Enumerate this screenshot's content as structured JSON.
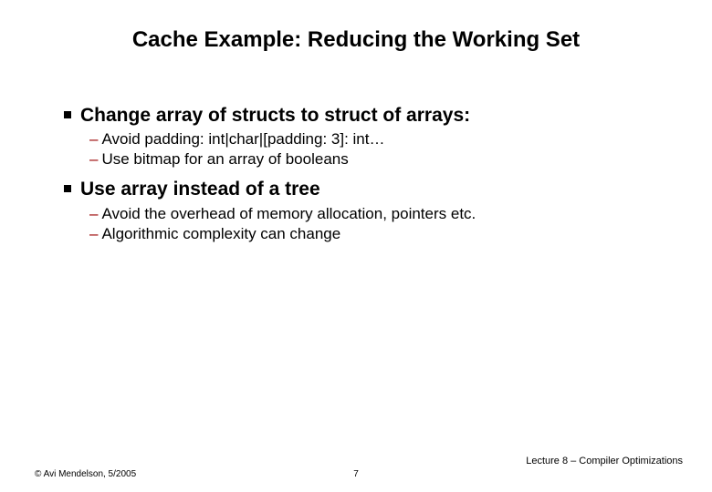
{
  "title": "Cache Example: Reducing the Working Set",
  "bullets": [
    {
      "text": "Change array of structs to struct of arrays:",
      "subs": [
        "Avoid padding: int|char|[padding: 3]: int…",
        "Use bitmap for an array of booleans"
      ]
    },
    {
      "text": "Use array instead of a tree",
      "subs": [
        "Avoid the overhead of memory allocation, pointers etc.",
        "Algorithmic complexity can change"
      ]
    }
  ],
  "footer": {
    "left": "© Avi Mendelson, 5/2005",
    "center": "7",
    "right": "Lecture 8 – Compiler Optimizations"
  }
}
